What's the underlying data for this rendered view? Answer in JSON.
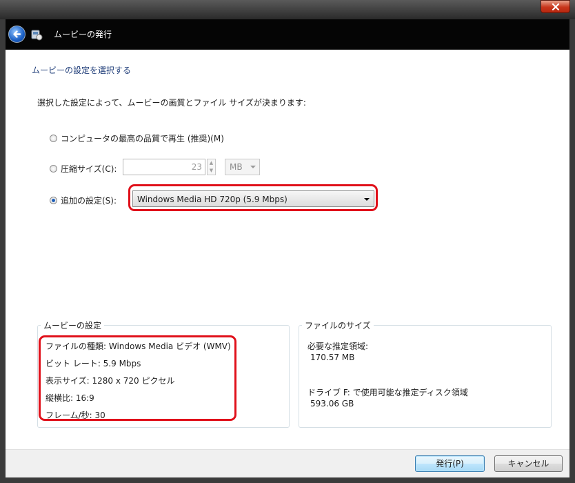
{
  "window": {
    "title": "ムービーの発行"
  },
  "page": {
    "heading": "ムービーの設定を選択する",
    "instruction": "選択した設定によって、ムービーの画質とファイル サイズが決まります:"
  },
  "options": {
    "best_quality_label": "コンピュータの最高の品質で再生 (推奨)(M)",
    "compress_label": "圧縮サイズ(C):",
    "compress_value": "23",
    "compress_unit": "MB",
    "additional_label": "追加の設定(S):",
    "additional_value": "Windows Media HD 720p (5.9 Mbps)"
  },
  "movie_settings": {
    "title": "ムービーの設定",
    "file_type": "ファイルの種類: Windows Media ビデオ (WMV)",
    "bitrate": "ビット レート: 5.9 Mbps",
    "display_size": "表示サイズ: 1280 x 720 ピクセル",
    "aspect_ratio": "縦横比: 16:9",
    "framerate": "フレーム/秒: 30"
  },
  "file_size": {
    "title": "ファイルのサイズ",
    "estimate_label": "必要な推定領域:",
    "estimate_value": "170.57 MB",
    "disk_label": "ドライブ F: で使用可能な推定ディスク領域",
    "disk_value": "593.06 GB"
  },
  "buttons": {
    "publish": "発行(P)",
    "cancel": "キャンセル"
  },
  "selected_option": "additional",
  "colors": {
    "heading": "#1e3c78",
    "highlight": "#e0101a",
    "nav_bar": "#050505"
  },
  "icons": [
    "close-icon",
    "back-arrow-icon",
    "app-icon",
    "spin-up-icon",
    "spin-down-icon",
    "dropdown-arrow-icon"
  ]
}
